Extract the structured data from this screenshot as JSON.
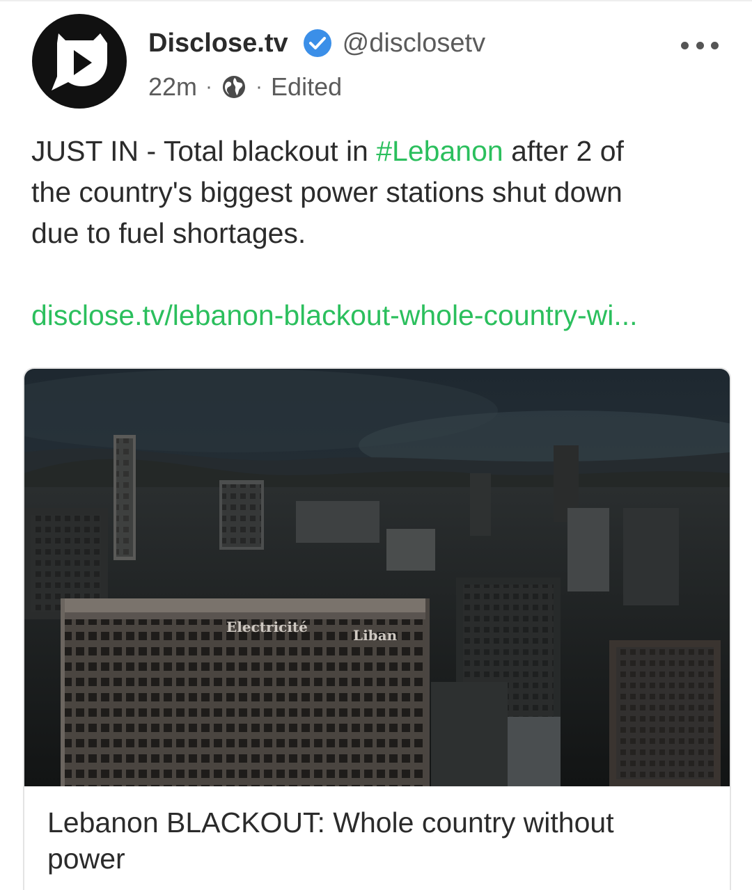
{
  "author": {
    "display_name": "Disclose.tv",
    "handle": "@disclosetv",
    "verified": true,
    "avatar": "disclose-tv-logo"
  },
  "meta": {
    "time_ago": "22m",
    "separator": "·",
    "visibility_icon": "globe-icon",
    "edited_label": "Edited"
  },
  "menu": {
    "icon": "more-horizontal-icon"
  },
  "post": {
    "text_line1_before": "JUST IN - Total blackout in ",
    "hashtag": "#Lebanon",
    "text_line1_after": " after 2 of",
    "text_line2": "the country's biggest power stations shut down",
    "text_line3": "due to fuel shortages.",
    "link": "disclose.tv/lebanon-blackout-whole-country-wi..."
  },
  "card": {
    "image_sign_left": "Electricité",
    "image_sign_right": "Liban",
    "title_line1": "Lebanon BLACKOUT: Whole country without",
    "title_line2": "power"
  },
  "colors": {
    "accent_green": "#2bbf5d",
    "verified_blue": "#3b8fe8",
    "text_primary": "#2b2b2b",
    "text_secondary": "#5b5b5b"
  }
}
